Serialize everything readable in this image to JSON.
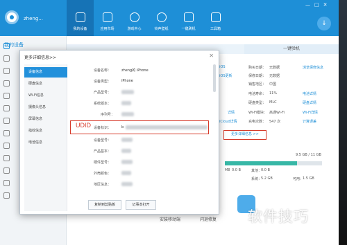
{
  "header": {
    "username": "zheng...",
    "nav": [
      {
        "label": "我的设备",
        "active": true
      },
      {
        "label": "应用市场"
      },
      {
        "label": "游戏中心"
      },
      {
        "label": "铃声壁纸"
      },
      {
        "label": "一键刷机"
      },
      {
        "label": "工具箱"
      }
    ],
    "window_controls": {
      "minimize": "—",
      "restore": "□",
      "close": "✕"
    },
    "download_icon": "↓"
  },
  "sidebar": {
    "title": "我的设备"
  },
  "background": {
    "onekey_tab": "一键验机",
    "info_rows": [
      {
        "label": "购买日期：",
        "value": "无数据",
        "link": "浏览保修信息"
      },
      {
        "label": "保修日期：",
        "value": "无数据"
      },
      {
        "label": "销售地区：",
        "value": "中国"
      },
      {
        "label": "电池寿命：",
        "value": "11%",
        "link": "电池详情"
      },
      {
        "label": "硬盘类型：",
        "value": "MLC",
        "link": "硬盘详情"
      },
      {
        "label": "Wi-Fi模块：",
        "value": "高通Wi-Fi",
        "link": "Wi-Fi详情"
      },
      {
        "label": "充电次数：",
        "value": "547 次",
        "link": "计算误差"
      }
    ],
    "left_links": [
      "iOS",
      "iOS更新",
      "详情",
      "iCloud详情"
    ],
    "more_info": "更多详细信息 >>",
    "storage_total": "9.5 GB / 11 GB",
    "storage_rows": [
      {
        "name": "M8",
        "value": "0.0 B"
      },
      {
        "name": "其他：",
        "value": "0.0 B"
      },
      {
        "name": "系统：",
        "value": "5.2 GB"
      },
      {
        "name": "可用：",
        "value": "1.5 GB"
      }
    ],
    "bottom_buttons": [
      "安装移动端",
      "闪退修复"
    ],
    "watermark": "软件技巧"
  },
  "dialog": {
    "title": "更多详细信息>>",
    "close_icon": "✕",
    "menu": [
      "设备信息",
      "硬盘信息",
      "Wi-Fi信息",
      "摄像头信息",
      "屏幕信息",
      "指纹信息",
      "电池信息"
    ],
    "fields": [
      {
        "label": "设备名称：",
        "value": "zheng的 iPhone"
      },
      {
        "label": "设备类型：",
        "value": "iPhone"
      },
      {
        "label": "产品型号：",
        "value": ""
      },
      {
        "label": "系统版本：",
        "value": ""
      },
      {
        "label": "序列号：",
        "value": ""
      },
      {
        "label": "设备标识：",
        "value": "b"
      },
      {
        "label": "设备型号：",
        "value": ""
      },
      {
        "label": "产品基本：",
        "value": ""
      },
      {
        "label": "硬件型号：",
        "value": ""
      },
      {
        "label": "外壳颜色：",
        "value": ""
      },
      {
        "label": "地区信息：",
        "value": ""
      }
    ],
    "udid_note": "UDID",
    "copy_button": "复制到剪贴板",
    "notepad_button": "记事本打开"
  }
}
